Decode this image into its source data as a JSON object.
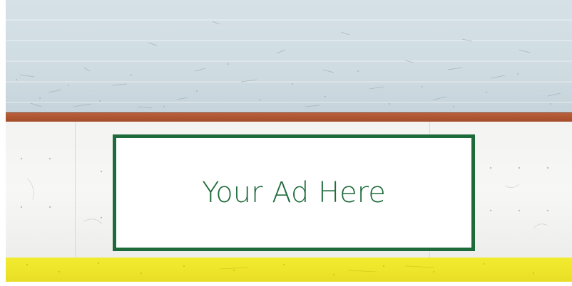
{
  "ad": {
    "text": "Your Ad Here",
    "border_color": "#1d6b3a",
    "text_color": "#1f6b3c"
  },
  "scene": {
    "ice_color": "#d0dce2",
    "kick_plate_color": "#b0553a",
    "boards_color": "#f4f4f2",
    "yellow_band_color": "#efe62c"
  }
}
